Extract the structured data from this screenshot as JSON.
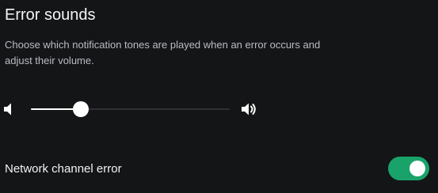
{
  "section": {
    "title": "Error sounds",
    "description": "Choose which notification tones are played when an error occurs and adjust their volume."
  },
  "volume": {
    "level_fraction": 0.25,
    "low_icon": "volume-low-icon",
    "high_icon": "volume-high-icon"
  },
  "toggles": [
    {
      "label": "Network channel error",
      "state": "on"
    }
  ],
  "colors": {
    "background": "#141517",
    "accent_on": "#19a36a",
    "track": "#2e3034"
  }
}
